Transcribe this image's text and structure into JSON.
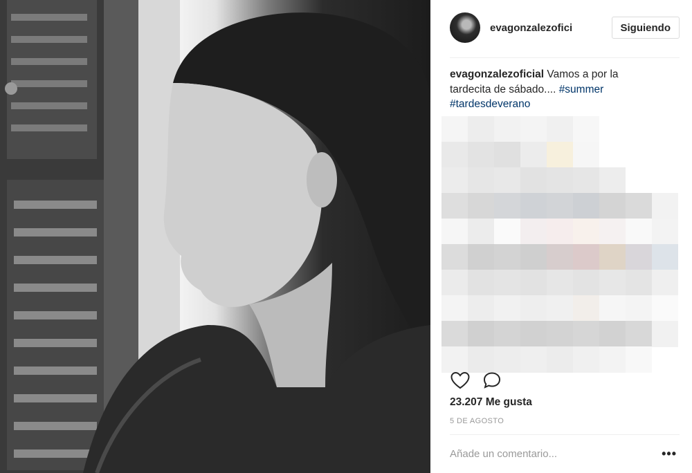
{
  "post": {
    "username": "evagonzalezofici",
    "follow_label": "Siguiendo",
    "caption": {
      "username": "evagonzalezoficial",
      "text_line1": " Vamos a por la",
      "text_line2": "tardecita de sábado.... ",
      "hashtag1": "#summer",
      "hashtag2": "#tardesdeverano"
    },
    "likes": "23.207 Me gusta",
    "date": "5 DE AGOSTO",
    "comment_placeholder": "Añade un comentario...",
    "more_label": "•••"
  },
  "icons": {
    "like": "heart-icon",
    "comment": "speech-bubble-icon"
  },
  "colors": {
    "hashtag": "#003569",
    "border": "#dbdbdb",
    "secondary_text": "#999999"
  }
}
